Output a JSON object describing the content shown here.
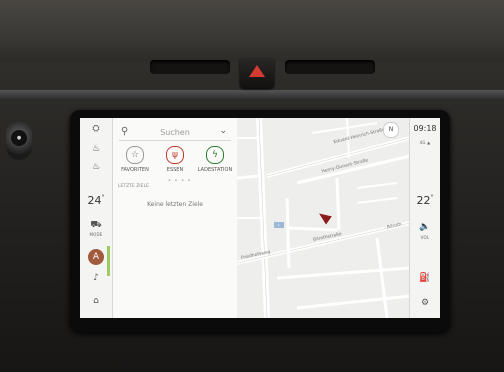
{
  "climate": {
    "left_temp": "24",
    "right_temp": "22",
    "temp_unit": "°"
  },
  "status": {
    "time": "09:18",
    "signal": "4G ▲"
  },
  "left_rail": {
    "items": [
      {
        "name": "seat-icon",
        "glyph": "⛭"
      },
      {
        "name": "seat-heat-icon",
        "glyph": "♨"
      },
      {
        "name": "rear-heat-icon",
        "glyph": "♨"
      },
      {
        "name": "car-mode-icon",
        "glyph": "⛟"
      }
    ],
    "mode_label": "MODE",
    "nav_badge": "A",
    "music_icon": "♪",
    "home_icon": "⌂"
  },
  "right_rail": {
    "volume_icon": "🔈",
    "volume_label": "VOL",
    "fuel_icon": "⛽",
    "settings_icon": "⚙"
  },
  "search": {
    "placeholder": "Suchen",
    "search_icon": "⚲",
    "chevron": "⌄"
  },
  "categories": [
    {
      "label": "FAVORITEN",
      "icon": "☆",
      "color": "#555555"
    },
    {
      "label": "ESSEN",
      "icon": "ψ",
      "color": "#c0392b"
    },
    {
      "label": "LADESTATION",
      "icon": "ϟ",
      "color": "#2e7d32"
    }
  ],
  "section_label": "LETZTE ZIELE",
  "empty_message": "Keine letzten Ziele",
  "map": {
    "compass": "N",
    "streets": [
      "Eduard-Heinrich-Straße",
      "Henry-Dunant-Straße",
      "Friedhofsweg",
      "Bilrothstraße",
      "Bilroth"
    ],
    "road_tag": "L"
  }
}
